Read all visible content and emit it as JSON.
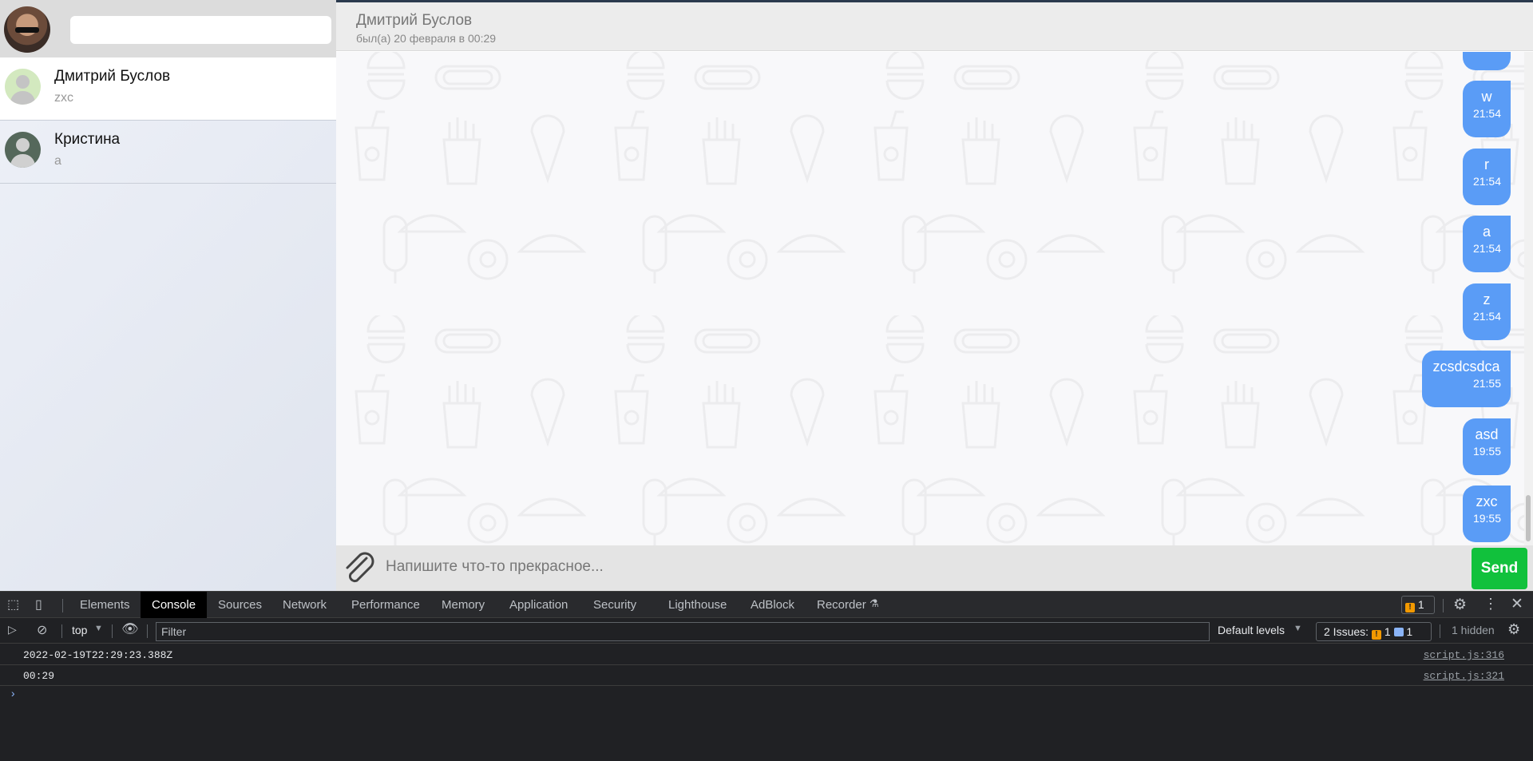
{
  "sidebar": {
    "search": {
      "placeholder": "",
      "value": ""
    },
    "contacts": [
      {
        "name": "Дмитрий Буслов",
        "preview": "zxc",
        "avatar_color": "#d3e9bf"
      },
      {
        "name": "Кристина",
        "preview": "а",
        "avatar_color": "#55685b"
      }
    ]
  },
  "chat": {
    "header": {
      "name": "Дмитрий Буслов",
      "status": "был(а) 20 февраля в 00:29"
    },
    "messages": [
      {
        "text": "w",
        "time": "21:54"
      },
      {
        "text": "r",
        "time": "21:54"
      },
      {
        "text": "a",
        "time": "21:54"
      },
      {
        "text": "z",
        "time": "21:54"
      },
      {
        "text": "zcsdcsdca",
        "time": "21:55"
      },
      {
        "text": "asd",
        "time": "19:55"
      },
      {
        "text": "zxc",
        "time": "19:55"
      }
    ],
    "composer": {
      "placeholder": "Напишите что-то прекрасное...",
      "send_label": "Send"
    },
    "colors": {
      "bubble": "#5a9cf6",
      "send": "#11c13c"
    }
  },
  "devtools": {
    "tabs": [
      "Elements",
      "Console",
      "Sources",
      "Network",
      "Performance",
      "Memory",
      "Application",
      "Security",
      "Lighthouse",
      "AdBlock",
      "Recorder"
    ],
    "active_tab": "Console",
    "warning_count": "1",
    "toolbar": {
      "context": "top",
      "filter_placeholder": "Filter",
      "levels": "Default levels",
      "issues_label": "2 Issues:",
      "issues_warn": "1",
      "issues_info": "1",
      "hidden": "1 hidden"
    },
    "logs": [
      {
        "message": "2022-02-19T22:29:23.388Z",
        "source": "script.js:316"
      },
      {
        "message": "00:29",
        "source": "script.js:321"
      }
    ],
    "prompt": "›"
  }
}
